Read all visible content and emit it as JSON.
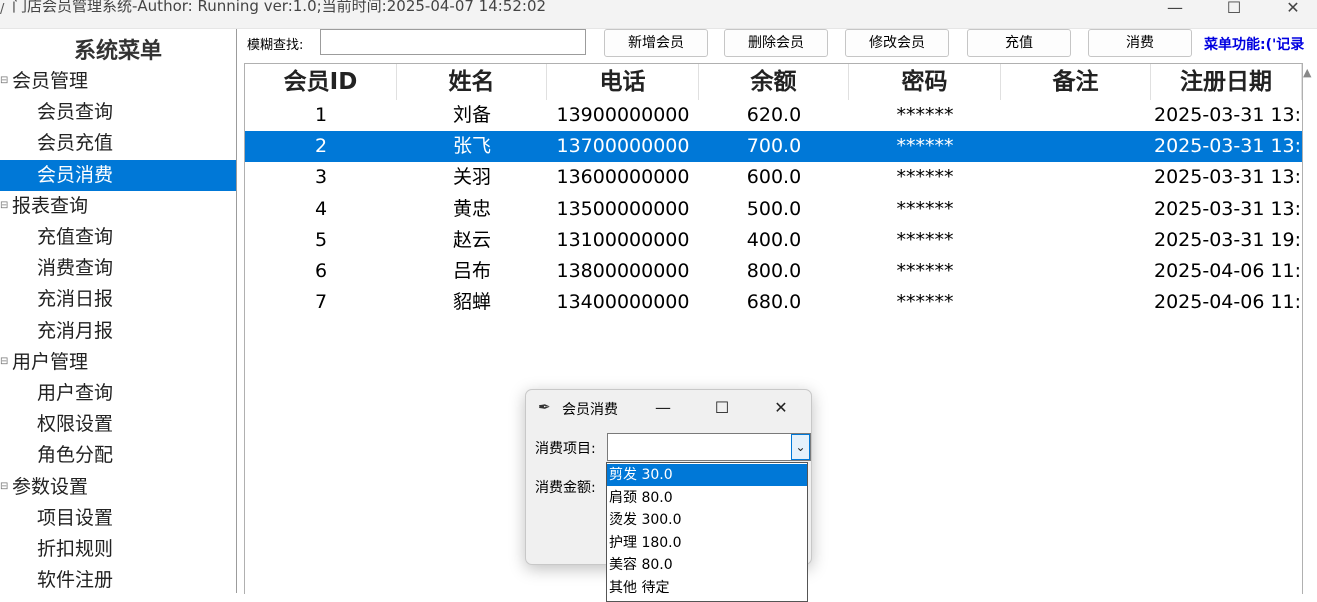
{
  "window": {
    "title": "门店会员管理系统-Author: Running  ver:1.0;当前时间:2025-04-07 14:52:02",
    "controls": {
      "minimize": "—",
      "maximize": "☐",
      "close": "✕"
    }
  },
  "sidebar": {
    "title": "系统菜单",
    "groups": [
      {
        "label": "会员管理",
        "items": [
          "会员查询",
          "会员充值",
          "会员消费"
        ]
      },
      {
        "label": "报表查询",
        "items": [
          "充值查询",
          "消费查询",
          "充消日报",
          "充消月报"
        ]
      },
      {
        "label": "用户管理",
        "items": [
          "用户查询",
          "权限设置",
          "角色分配"
        ]
      },
      {
        "label": "参数设置",
        "items": [
          "项目设置",
          "折扣规则",
          "软件注册"
        ]
      }
    ],
    "selected_item": "会员消费"
  },
  "toolbar": {
    "search_label": "模糊查找:",
    "search_value": "",
    "buttons": {
      "add": "新增会员",
      "delete": "删除会员",
      "edit": "修改会员",
      "recharge": "充值",
      "consume": "消费"
    },
    "menu_function": "菜单功能:('记录"
  },
  "table": {
    "columns": [
      "会员ID",
      "姓名",
      "电话",
      "余额",
      "密码",
      "备注",
      "注册日期"
    ],
    "rows": [
      [
        "1",
        "刘备",
        "13900000000",
        "620.0",
        "******",
        "",
        "2025-03-31 13:"
      ],
      [
        "2",
        "张飞",
        "13700000000",
        "700.0",
        "******",
        "",
        "2025-03-31 13:"
      ],
      [
        "3",
        "关羽",
        "13600000000",
        "600.0",
        "******",
        "",
        "2025-03-31 13:"
      ],
      [
        "4",
        "黄忠",
        "13500000000",
        "500.0",
        "******",
        "",
        "2025-03-31 13:"
      ],
      [
        "5",
        "赵云",
        "13100000000",
        "400.0",
        "******",
        "",
        "2025-03-31 19:"
      ],
      [
        "6",
        "吕布",
        "13800000000",
        "800.0",
        "******",
        "",
        "2025-04-06 11:"
      ],
      [
        "7",
        "貂蝉",
        "13400000000",
        "680.0",
        "******",
        "",
        "2025-04-06 11:"
      ]
    ],
    "selected_row": 1
  },
  "dialog": {
    "title": "会员消费",
    "item_label": "消费项目:",
    "item_value": "",
    "amount_label": "消费金额:",
    "options": [
      "剪发 30.0",
      "肩颈 80.0",
      "烫发 300.0",
      "护理 180.0",
      "美容 80.0",
      "其他 待定"
    ],
    "highlighted_option": 0
  },
  "colors": {
    "selection": "#0078d7",
    "menu_function_text": "#0000e0"
  }
}
